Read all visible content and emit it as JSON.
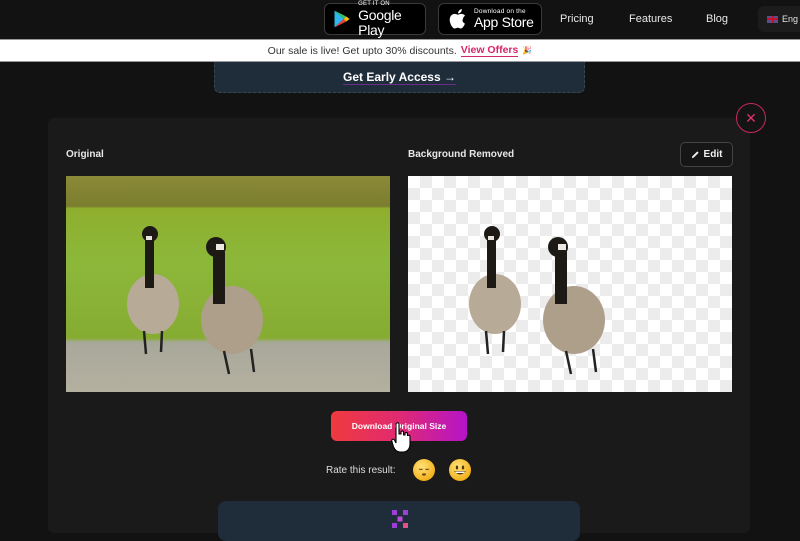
{
  "topbar": {
    "google_play": {
      "small": "GET IT ON",
      "big": "Google Play"
    },
    "app_store": {
      "small": "Download on the",
      "big": "App Store"
    },
    "nav": [
      "Pricing",
      "Features",
      "Blog"
    ],
    "language": "Eng"
  },
  "banner": {
    "text": "Our sale is live! Get upto 30% discounts.",
    "link": "View Offers",
    "emoji": "🎉"
  },
  "early_access": "Get Early Access →",
  "close_icon": "✕",
  "result": {
    "original_label": "Original",
    "removed_label": "Background Removed",
    "edit_label": "Edit",
    "download_label": "Download Original Size",
    "rate_label": "Rate this result:"
  },
  "colors": {
    "accent_pink": "#d6266a",
    "download_gradient_start": "#f03a3e",
    "download_gradient_end": "#b514c8",
    "card_bg": "#1f2d3b"
  }
}
